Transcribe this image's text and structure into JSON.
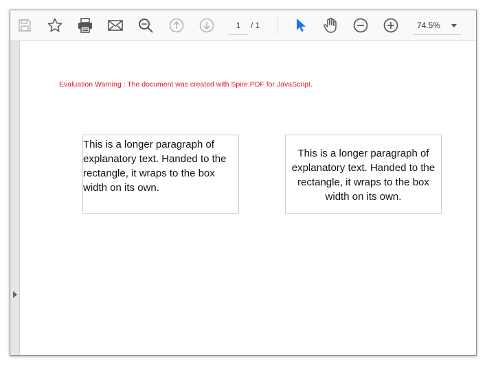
{
  "toolbar": {
    "buttons": [
      {
        "name": "save-icon",
        "enabled": false
      },
      {
        "name": "star-icon",
        "enabled": true
      },
      {
        "name": "print-icon",
        "enabled": true
      },
      {
        "name": "mail-icon",
        "enabled": true
      },
      {
        "name": "search-icon",
        "enabled": true
      },
      {
        "name": "arrow-up-icon",
        "enabled": false
      },
      {
        "name": "arrow-down-icon",
        "enabled": false
      },
      {
        "name": "cursor-icon",
        "enabled": true
      },
      {
        "name": "hand-icon",
        "enabled": true
      },
      {
        "name": "zoom-out-icon",
        "enabled": true
      },
      {
        "name": "zoom-in-icon",
        "enabled": true
      }
    ],
    "page_current": "1",
    "page_total": "/ 1",
    "zoom_level": "74.5%"
  },
  "colors": {
    "accent": "#1a73e8",
    "warning": "#e6151c",
    "icon": "#555555",
    "icon_disabled": "#b5b5b5"
  },
  "document": {
    "warning": "Evaluation Warning : The document was created with Spire.PDF for JavaScript.",
    "box_left_text": "This is a longer paragraph of explanatory text. Handed to the rectangle, it wraps to the box width on its own.",
    "box_right_text": "This is a longer paragraph of explanatory text. Handed to the rectangle, it wraps to the box width on its own."
  }
}
